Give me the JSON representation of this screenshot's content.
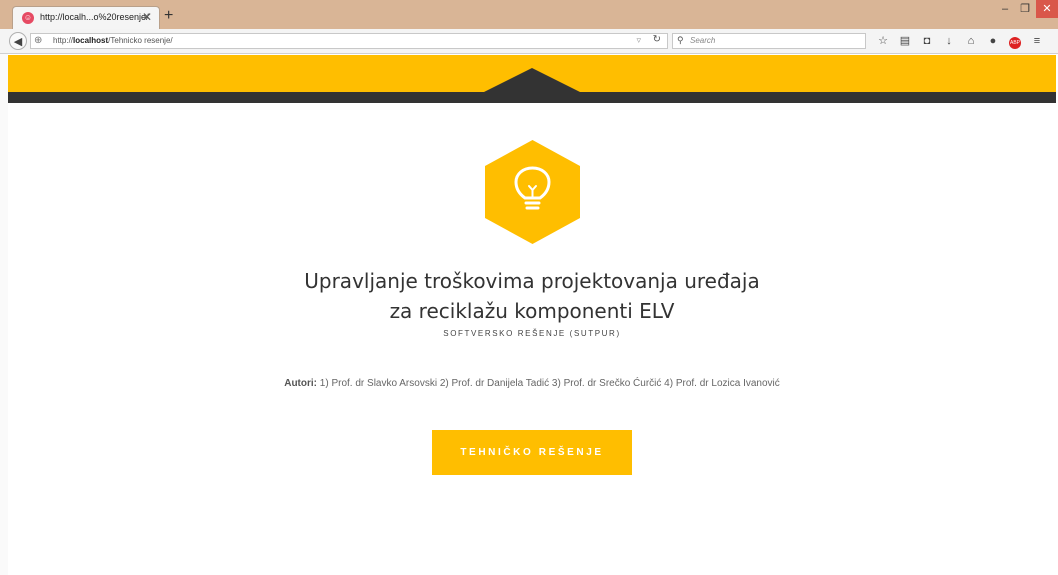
{
  "browser": {
    "tab_title": "http://localh...o%20resenje/",
    "tab_close": "✕",
    "new_tab": "+",
    "url_prefix": "http://",
    "url_host": "localhost",
    "url_path": "/Tehnicko resenje/",
    "search_placeholder": "Search",
    "window": {
      "minimize": "–",
      "restore": "❐",
      "close": "✕"
    }
  },
  "page": {
    "title_line1": "Upravljanje troškovima projektovanja uređaja",
    "title_line2": "za reciklažu komponenti ELV",
    "subtitle": "SOFTVERSKO REŠENJE (SUTPUR)",
    "authors_label": "Autori:",
    "authors_text": "1) Prof. dr Slavko Arsovski 2) Prof. dr Danijela Tadić 3) Prof. dr Srečko Ćurčić 4) Prof. dr Lozica Ivanović",
    "cta_label": "TEHNIČKO REŠENJE"
  },
  "icons": {
    "logo": "lightbulb-icon",
    "toolbar": [
      "star-icon",
      "reading-list-icon",
      "pocket-icon",
      "download-icon",
      "home-icon",
      "chat-icon",
      "adblock-icon",
      "menu-icon"
    ]
  },
  "colors": {
    "accent_yellow": "#ffbe00",
    "header_dark": "#333333",
    "titlebar": "#d9b596"
  }
}
